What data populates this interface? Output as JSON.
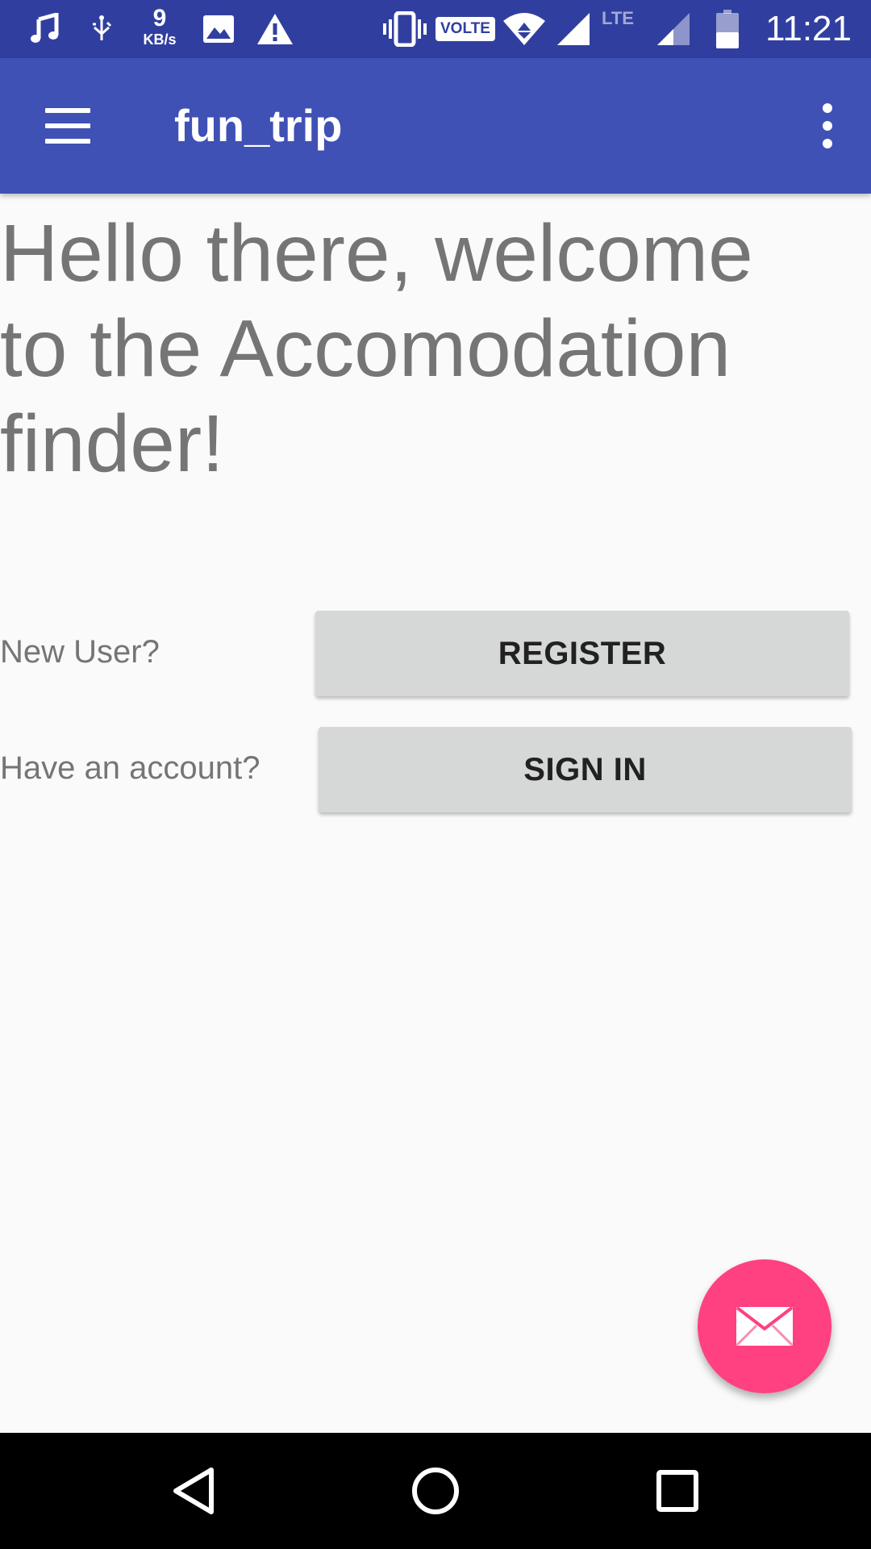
{
  "status_bar": {
    "speed_value": "9",
    "speed_unit": "KB/s",
    "volte_label": "VOLTE",
    "lte_label": "LTE",
    "time": "11:21",
    "icons": [
      "music-note-icon",
      "usb-debug-icon",
      "image-icon",
      "warning-icon",
      "vibrate-icon",
      "wifi-icon",
      "signal-icon",
      "signal-weak-icon",
      "battery-icon"
    ]
  },
  "app_bar": {
    "title": "fun_trip",
    "menu_icon": "hamburger-menu-icon",
    "overflow_icon": "more-vert-icon"
  },
  "main": {
    "welcome_text": "Hello there, welcome to the Accomodation finder!",
    "register_row": {
      "label": "New User?",
      "button": "REGISTER"
    },
    "signin_row": {
      "label": "Have an account?",
      "button": "SIGN IN"
    }
  },
  "fab": {
    "icon": "mail-icon"
  },
  "nav_bar": {
    "icons": [
      "back-icon",
      "home-icon",
      "recents-icon"
    ]
  },
  "colors": {
    "status_bar": "#303f9f",
    "primary": "#3f51b5",
    "accent": "#ff4081",
    "button_bg": "#d6d7d7",
    "text_secondary": "#757575"
  }
}
